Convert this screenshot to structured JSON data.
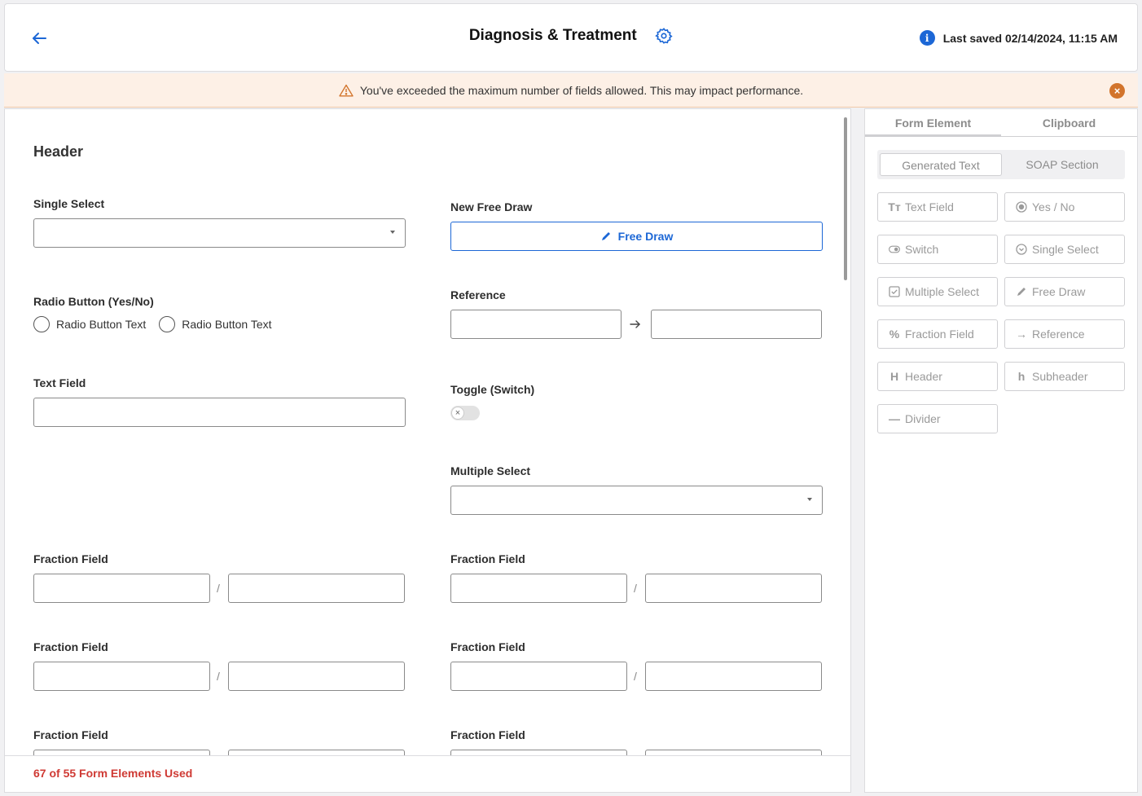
{
  "header": {
    "title": "Diagnosis & Treatment",
    "last_saved": "Last saved 02/14/2024, 11:15 AM",
    "info_glyph": "i"
  },
  "warning": {
    "message": "You've exceeded the maximum number of fields allowed. This may impact performance.",
    "close_glyph": "×",
    "color": "#d2742c"
  },
  "form": {
    "header": "Header",
    "single_select_label": "Single Select",
    "new_free_draw_label": "New Free Draw",
    "free_draw_button": "Free Draw",
    "radio_label": "Radio Button (Yes/No)",
    "radio_options": [
      "Radio Button Text",
      "Radio Button Text"
    ],
    "reference_label": "Reference",
    "text_field_label": "Text Field",
    "toggle_label": "Toggle (Switch)",
    "toggle_glyph": "×",
    "multiple_select_label": "Multiple Select",
    "fraction_label": "Fraction Field",
    "fraction_separator": "/",
    "footer": "67 of 55 Form Elements Used"
  },
  "side": {
    "tabs": [
      "Form Element",
      "Clipboard"
    ],
    "subtabs": [
      "Generated Text",
      "SOAP Section"
    ],
    "elements": [
      {
        "label": "Text Field",
        "icon": "text-field-icon",
        "glyph": "Tт"
      },
      {
        "label": "Yes / No",
        "icon": "radio-icon",
        "glyph": ""
      },
      {
        "label": "Switch",
        "icon": "switch-icon",
        "glyph": ""
      },
      {
        "label": "Single Select",
        "icon": "single-select-icon",
        "glyph": ""
      },
      {
        "label": "Multiple Select",
        "icon": "checkbox-icon",
        "glyph": ""
      },
      {
        "label": "Free Draw",
        "icon": "pencil-icon",
        "glyph": ""
      },
      {
        "label": "Fraction Field",
        "icon": "percent-icon",
        "glyph": "%"
      },
      {
        "label": "Reference",
        "icon": "arrow-right-icon",
        "glyph": "→"
      },
      {
        "label": "Header",
        "icon": "header-icon",
        "glyph": "H"
      },
      {
        "label": "Subheader",
        "icon": "subheader-icon",
        "glyph": "h"
      },
      {
        "label": "Divider",
        "icon": "divider-icon",
        "glyph": "—"
      }
    ]
  },
  "colors": {
    "accent": "#1c67d6",
    "error": "#cf3a34",
    "warning_bg": "#fdf0e6"
  }
}
